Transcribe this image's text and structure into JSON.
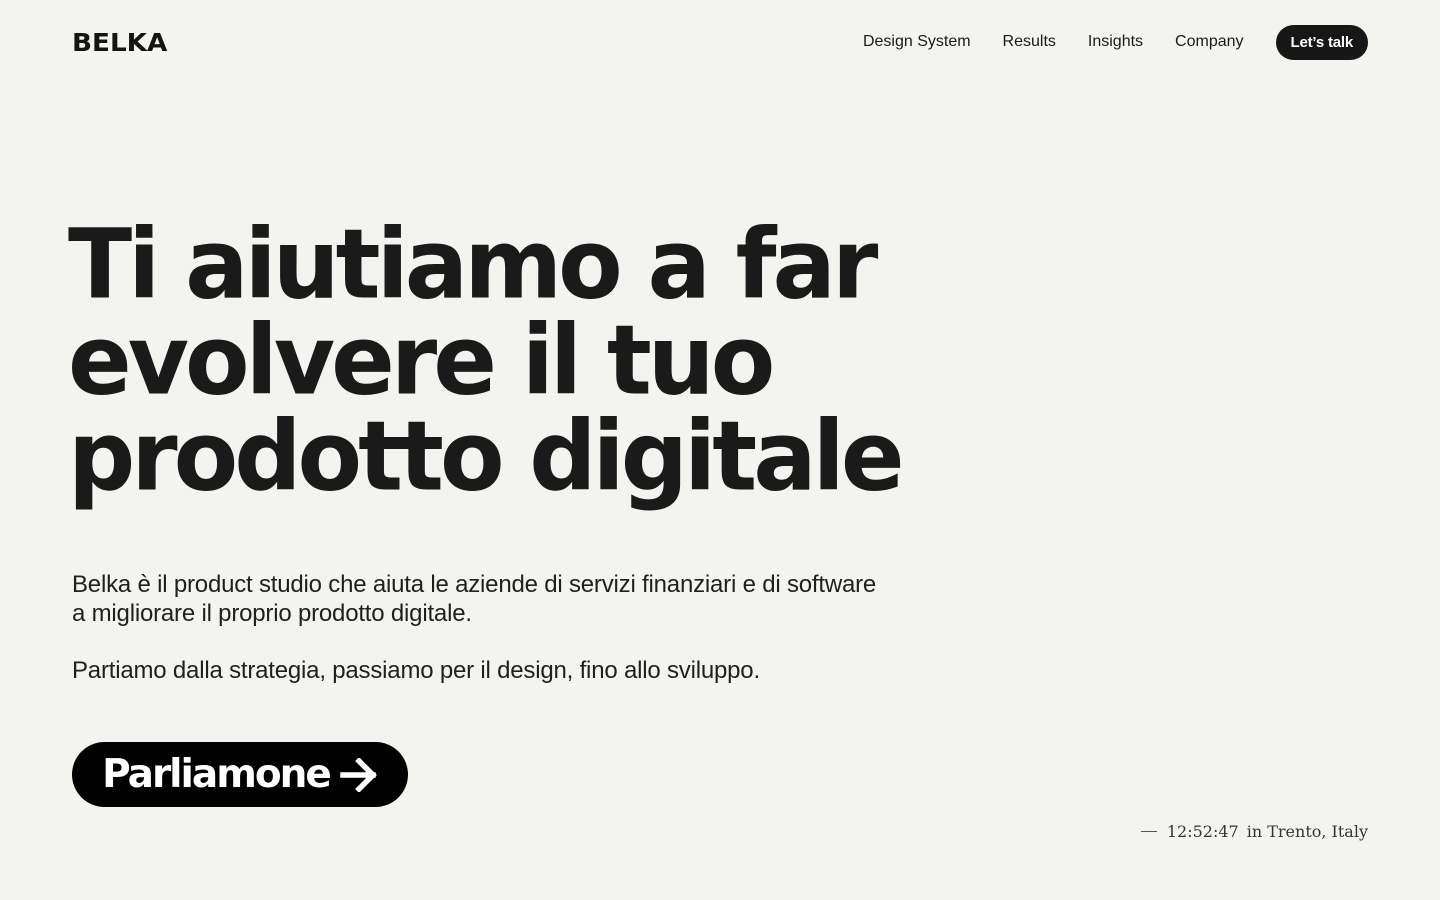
{
  "brand": {
    "logo": "BELKA"
  },
  "nav": {
    "items": [
      {
        "label": "Design System"
      },
      {
        "label": "Results"
      },
      {
        "label": "Insights"
      },
      {
        "label": "Company"
      }
    ],
    "cta_label": "Let’s talk"
  },
  "hero": {
    "title_lines": [
      "Ti aiutiamo a far",
      "evolvere il tuo",
      "prodotto digitale"
    ],
    "paragraph_1": "Belka è il product studio che aiuta le aziende di servizi finanziari e di software a migliorare il proprio prodotto digitale.",
    "paragraph_2": "Partiamo dalla strategia, passiamo per il design, fino allo sviluppo.",
    "cta_label": "Parliamone",
    "cta_icon": "arrow-right-icon"
  },
  "clock": {
    "time": "12:52:47",
    "location": "in Trento, Italy"
  },
  "colors": {
    "background": "#f3f4ef",
    "text": "#1a1a1a",
    "button": "#171717"
  }
}
